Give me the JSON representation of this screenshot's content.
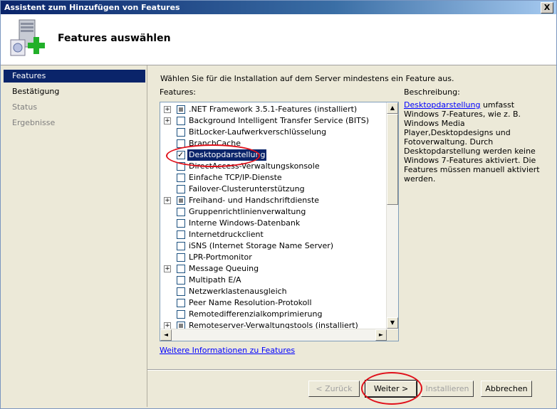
{
  "window": {
    "title": "Assistent zum Hinzufügen von Features",
    "close_label": "X"
  },
  "header": {
    "title": "Features auswählen",
    "icon": "server-add-feature-icon"
  },
  "nav": {
    "items": [
      {
        "label": "Features",
        "state": "active"
      },
      {
        "label": "Bestätigung",
        "state": "normal"
      },
      {
        "label": "Status",
        "state": "disabled"
      },
      {
        "label": "Ergebnisse",
        "state": "disabled"
      }
    ]
  },
  "content": {
    "instruction": "Wählen Sie für die Installation auf dem Server mindestens ein Feature aus.",
    "features_label": "Features:",
    "description_label": "Beschreibung:",
    "description_link": "Desktopdarstellung",
    "description_text": " umfasst Windows 7-Features, wie z. B. Windows Media Player,Desktopdesigns und Fotoverwaltung. Durch Desktopdarstellung werden keine Windows 7-Features aktiviert. Die Features müssen manuell aktiviert werden.",
    "more_link": "Weitere Informationen zu Features"
  },
  "features": [
    {
      "label": ".NET Framework 3.5.1-Features  (installiert)",
      "expandable": true,
      "state": "partial"
    },
    {
      "label": "Background Intelligent Transfer Service (BITS)",
      "expandable": true,
      "state": "unchecked"
    },
    {
      "label": "BitLocker-Laufwerkverschlüsselung",
      "expandable": false,
      "state": "unchecked"
    },
    {
      "label": "BranchCache",
      "expandable": false,
      "state": "unchecked"
    },
    {
      "label": "Desktopdarstellung",
      "expandable": false,
      "state": "checked",
      "selected": true
    },
    {
      "label": "DirectAccess-Verwaltungskonsole",
      "expandable": false,
      "state": "unchecked"
    },
    {
      "label": "Einfache TCP/IP-Dienste",
      "expandable": false,
      "state": "unchecked"
    },
    {
      "label": "Failover-Clusterunterstützung",
      "expandable": false,
      "state": "unchecked"
    },
    {
      "label": "Freihand- und Handschriftdienste",
      "expandable": true,
      "state": "partial"
    },
    {
      "label": "Gruppenrichtlinienverwaltung",
      "expandable": false,
      "state": "unchecked"
    },
    {
      "label": "Interne Windows-Datenbank",
      "expandable": false,
      "state": "unchecked"
    },
    {
      "label": "Internetdruckclient",
      "expandable": false,
      "state": "unchecked"
    },
    {
      "label": "iSNS (Internet Storage Name Server)",
      "expandable": false,
      "state": "unchecked"
    },
    {
      "label": "LPR-Portmonitor",
      "expandable": false,
      "state": "unchecked"
    },
    {
      "label": "Message Queuing",
      "expandable": true,
      "state": "unchecked"
    },
    {
      "label": "Multipath E/A",
      "expandable": false,
      "state": "unchecked"
    },
    {
      "label": "Netzwerklastenausgleich",
      "expandable": false,
      "state": "unchecked"
    },
    {
      "label": "Peer Name Resolution-Protokoll",
      "expandable": false,
      "state": "unchecked"
    },
    {
      "label": "Remotedifferenzialkomprimierung",
      "expandable": false,
      "state": "unchecked"
    },
    {
      "label": "Remoteserver-Verwaltungstools  (installiert)",
      "expandable": true,
      "state": "partial"
    }
  ],
  "buttons": {
    "back": "< Zurück",
    "next": "Weiter >",
    "install": "Installieren",
    "cancel": "Abbrechen"
  },
  "colors": {
    "annotation": "#e0101a",
    "selection": "#0a246a",
    "link": "#0000ff"
  }
}
